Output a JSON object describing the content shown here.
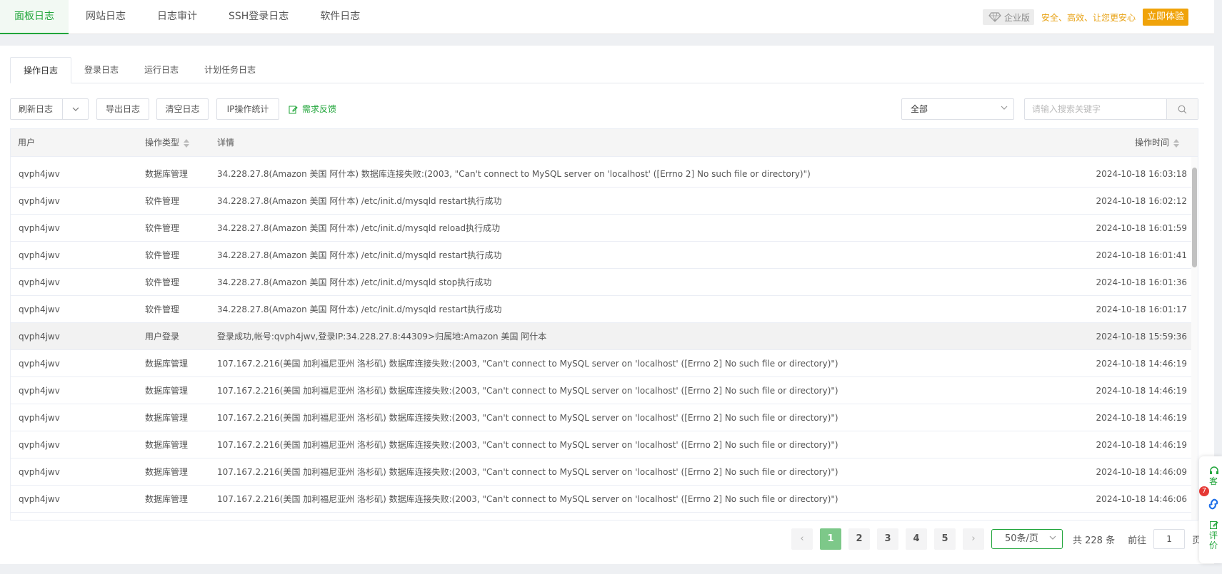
{
  "topnav": {
    "tabs": [
      "面板日志",
      "网站日志",
      "日志审计",
      "SSH登录日志",
      "软件日志"
    ],
    "active": 0,
    "promo": {
      "edition": "企业版",
      "slogan": "安全、高效、让您更安心",
      "try_label": "立即体验"
    }
  },
  "subtabs": {
    "items": [
      "操作日志",
      "登录日志",
      "运行日志",
      "计划任务日志"
    ],
    "active": 0
  },
  "toolbar": {
    "refresh": "刷新日志",
    "export": "导出日志",
    "clear": "清空日志",
    "ip_stats": "IP操作统计",
    "feedback": "需求反馈",
    "filter_value": "全部",
    "search_placeholder": "请输入搜索关键字"
  },
  "table": {
    "headers": {
      "user": "用户",
      "type": "操作类型",
      "detail": "详情",
      "time": "操作时间"
    },
    "rows": [
      {
        "user": "qvph4jwv",
        "type": "数据库管理",
        "detail": "34.228.27.8(Amazon 美国 阿什本) 数据库连接失败:(2003, \"Can't connect to MySQL server on 'localhost' ([Errno 2] No such file or directory)\")",
        "time": "2024-10-18 16:03:18"
      },
      {
        "user": "qvph4jwv",
        "type": "软件管理",
        "detail": "34.228.27.8(Amazon 美国 阿什本) /etc/init.d/mysqld restart执行成功",
        "time": "2024-10-18 16:02:12"
      },
      {
        "user": "qvph4jwv",
        "type": "软件管理",
        "detail": "34.228.27.8(Amazon 美国 阿什本) /etc/init.d/mysqld reload执行成功",
        "time": "2024-10-18 16:01:59"
      },
      {
        "user": "qvph4jwv",
        "type": "软件管理",
        "detail": "34.228.27.8(Amazon 美国 阿什本) /etc/init.d/mysqld restart执行成功",
        "time": "2024-10-18 16:01:41"
      },
      {
        "user": "qvph4jwv",
        "type": "软件管理",
        "detail": "34.228.27.8(Amazon 美国 阿什本) /etc/init.d/mysqld stop执行成功",
        "time": "2024-10-18 16:01:36"
      },
      {
        "user": "qvph4jwv",
        "type": "软件管理",
        "detail": "34.228.27.8(Amazon 美国 阿什本) /etc/init.d/mysqld restart执行成功",
        "time": "2024-10-18 16:01:17"
      },
      {
        "user": "qvph4jwv",
        "type": "用户登录",
        "detail": "登录成功,帐号:qvph4jwv,登录IP:34.228.27.8:44309>归属地:Amazon 美国 阿什本",
        "time": "2024-10-18 15:59:36"
      },
      {
        "user": "qvph4jwv",
        "type": "数据库管理",
        "detail": "107.167.2.216(美国 加利福尼亚州 洛杉矶) 数据库连接失败:(2003, \"Can't connect to MySQL server on 'localhost' ([Errno 2] No such file or directory)\")",
        "time": "2024-10-18 14:46:19"
      },
      {
        "user": "qvph4jwv",
        "type": "数据库管理",
        "detail": "107.167.2.216(美国 加利福尼亚州 洛杉矶) 数据库连接失败:(2003, \"Can't connect to MySQL server on 'localhost' ([Errno 2] No such file or directory)\")",
        "time": "2024-10-18 14:46:19"
      },
      {
        "user": "qvph4jwv",
        "type": "数据库管理",
        "detail": "107.167.2.216(美国 加利福尼亚州 洛杉矶) 数据库连接失败:(2003, \"Can't connect to MySQL server on 'localhost' ([Errno 2] No such file or directory)\")",
        "time": "2024-10-18 14:46:19"
      },
      {
        "user": "qvph4jwv",
        "type": "数据库管理",
        "detail": "107.167.2.216(美国 加利福尼亚州 洛杉矶) 数据库连接失败:(2003, \"Can't connect to MySQL server on 'localhost' ([Errno 2] No such file or directory)\")",
        "time": "2024-10-18 14:46:19"
      },
      {
        "user": "qvph4jwv",
        "type": "数据库管理",
        "detail": "107.167.2.216(美国 加利福尼亚州 洛杉矶) 数据库连接失败:(2003, \"Can't connect to MySQL server on 'localhost' ([Errno 2] No such file or directory)\")",
        "time": "2024-10-18 14:46:09"
      },
      {
        "user": "qvph4jwv",
        "type": "数据库管理",
        "detail": "107.167.2.216(美国 加利福尼亚州 洛杉矶) 数据库连接失败:(2003, \"Can't connect to MySQL server on 'localhost' ([Errno 2] No such file or directory)\")",
        "time": "2024-10-18 14:46:06"
      }
    ],
    "highlight_row": 6
  },
  "pagination": {
    "pages": [
      "1",
      "2",
      "3",
      "4",
      "5"
    ],
    "active": 0,
    "page_size": "50条/页",
    "total": "共 228 条",
    "goto_label": "前往",
    "goto_value": "1",
    "page_suffix": "页"
  },
  "float_widget": {
    "badge": "7",
    "top_text": "客",
    "bottom_text": "评价"
  },
  "colors": {
    "accent": "#20a53a",
    "promo": "#f0a30a"
  }
}
